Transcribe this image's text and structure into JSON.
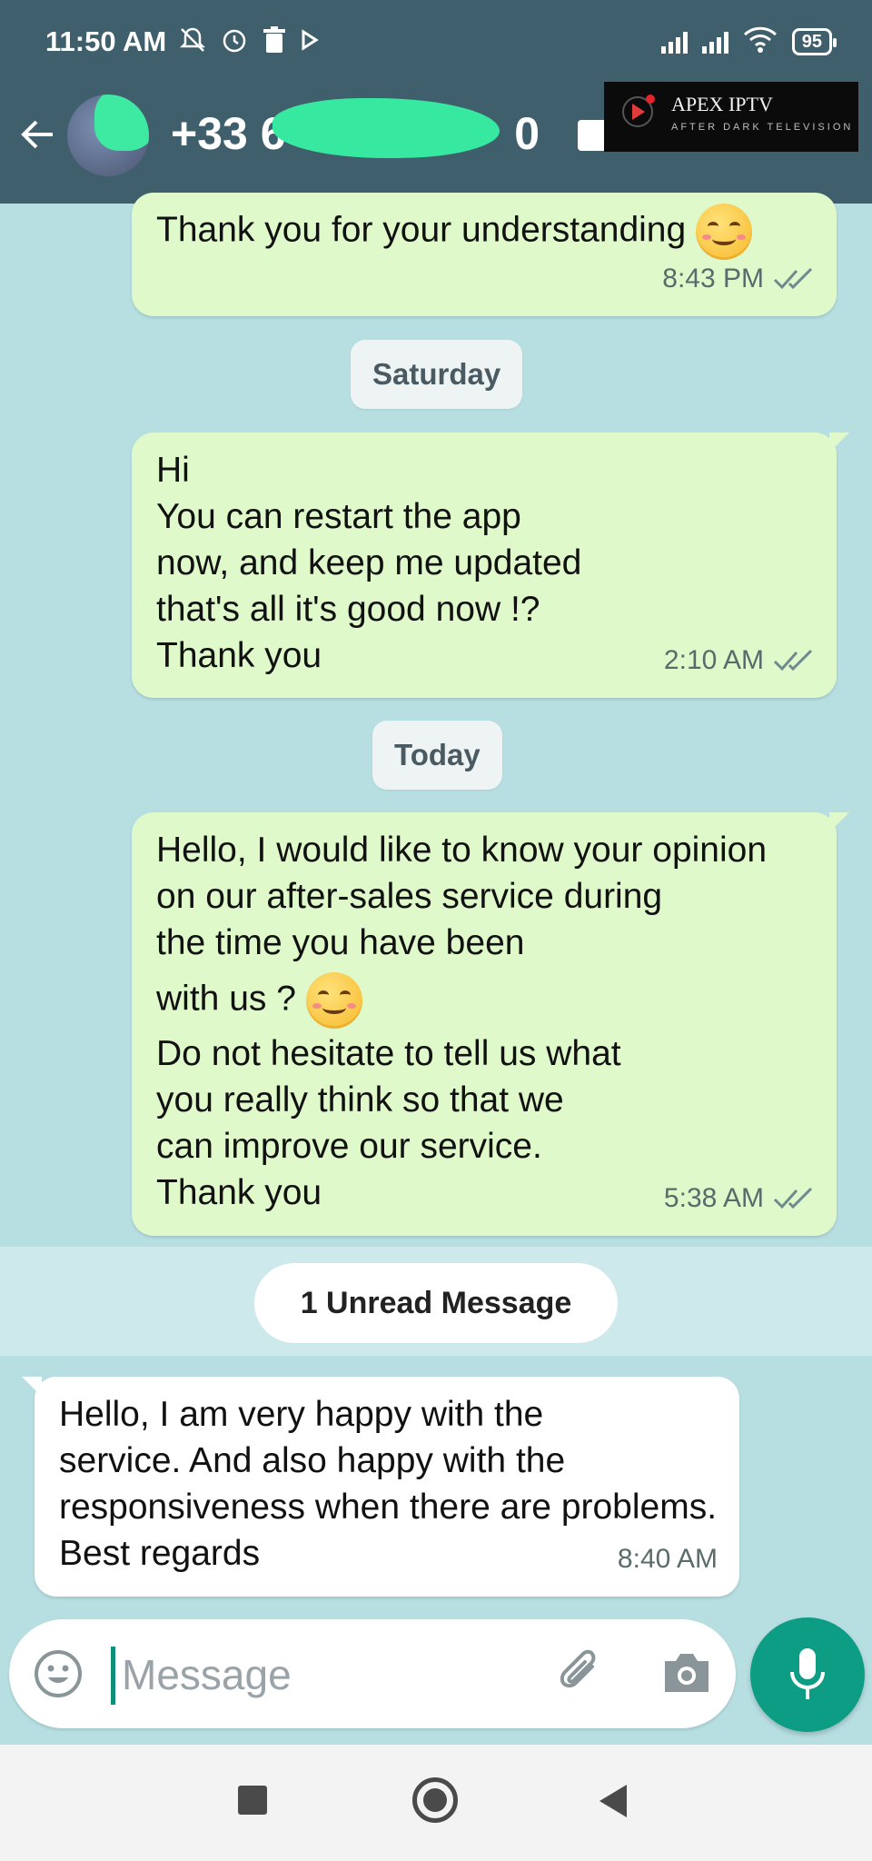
{
  "status_bar": {
    "time": "11:50 AM",
    "icons_left": [
      "mute-notification-icon",
      "alarm-icon",
      "trash-icon",
      "play-icon"
    ],
    "battery": "95"
  },
  "header": {
    "contact_name": "+33 6 3",
    "contact_suffix": "0",
    "overlay": {
      "title": "APEX IPTV",
      "subtitle": "AFTER DARK TELEVISION"
    }
  },
  "messages": [
    {
      "direction": "out",
      "text": "Thank you for your understanding",
      "time": "8:43 PM",
      "status": "read"
    },
    {
      "type": "date",
      "label": "Saturday"
    },
    {
      "direction": "out",
      "text": "Hi\nYou can restart the app\nnow, and keep me updated\nthat's all it's good now !?\nThank you",
      "time": "2:10 AM",
      "status": "read"
    },
    {
      "type": "date",
      "label": "Today"
    },
    {
      "direction": "out",
      "text_part1": "Hello, I would like to know your opinion\non our after-sales service during\nthe time you have been",
      "text_part2": "with us ?",
      "text_part3": "Do not hesitate to tell us what\nyou really think so that we\ncan improve our service.\nThank you",
      "time": "5:38 AM",
      "status": "read"
    },
    {
      "type": "unread",
      "label": "1 Unread Message"
    },
    {
      "direction": "in",
      "text": "Hello, I am very happy with the\nservice. And also happy with the\nresponsiveness when there are problems.\nBest regards",
      "time": "8:40 AM"
    }
  ],
  "composer": {
    "placeholder": "Message"
  },
  "colors": {
    "header_bg": "#3f5f6c",
    "chat_bg": "#b7dfe2",
    "outgoing_bubble": "#dff9cb",
    "incoming_bubble": "#ffffff",
    "accent": "#0d9d84"
  }
}
